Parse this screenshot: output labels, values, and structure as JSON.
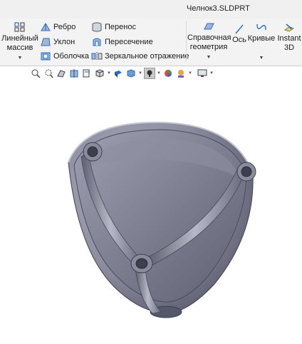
{
  "window": {
    "title": "Челнок3.SLDPRT"
  },
  "ribbon": {
    "linear_pattern": {
      "line1": "Линейный",
      "line2": "массив"
    },
    "rib": "Ребро",
    "draft": "Уклон",
    "shell": "Оболочка",
    "move": "Перенос",
    "intersect": "Пересечение",
    "mirror": "Зеркальное отражение",
    "reference_geometry": {
      "line1": "Справочная",
      "line2": "геометрия"
    },
    "axis": "Ось",
    "curves": "Кривые",
    "instant3d": {
      "line1": "Instant",
      "line2": "3D"
    }
  },
  "headsup": {
    "items": [
      "zoom-to-fit-icon",
      "zoom-to-area-icon",
      "previous-view-icon",
      "section-view-icon",
      "dynamic-annotation-icon",
      "view-orientation-icon",
      "display-style-icon",
      "hide-show-icon",
      "edit-appearance-icon",
      "apply-scene-icon",
      "view-settings-icon"
    ]
  },
  "colors": {
    "part_body": "#8a8c9e",
    "part_dark": "#4f5162",
    "part_light": "#b5b7c6",
    "accent_blue": "#2b6cc4"
  }
}
